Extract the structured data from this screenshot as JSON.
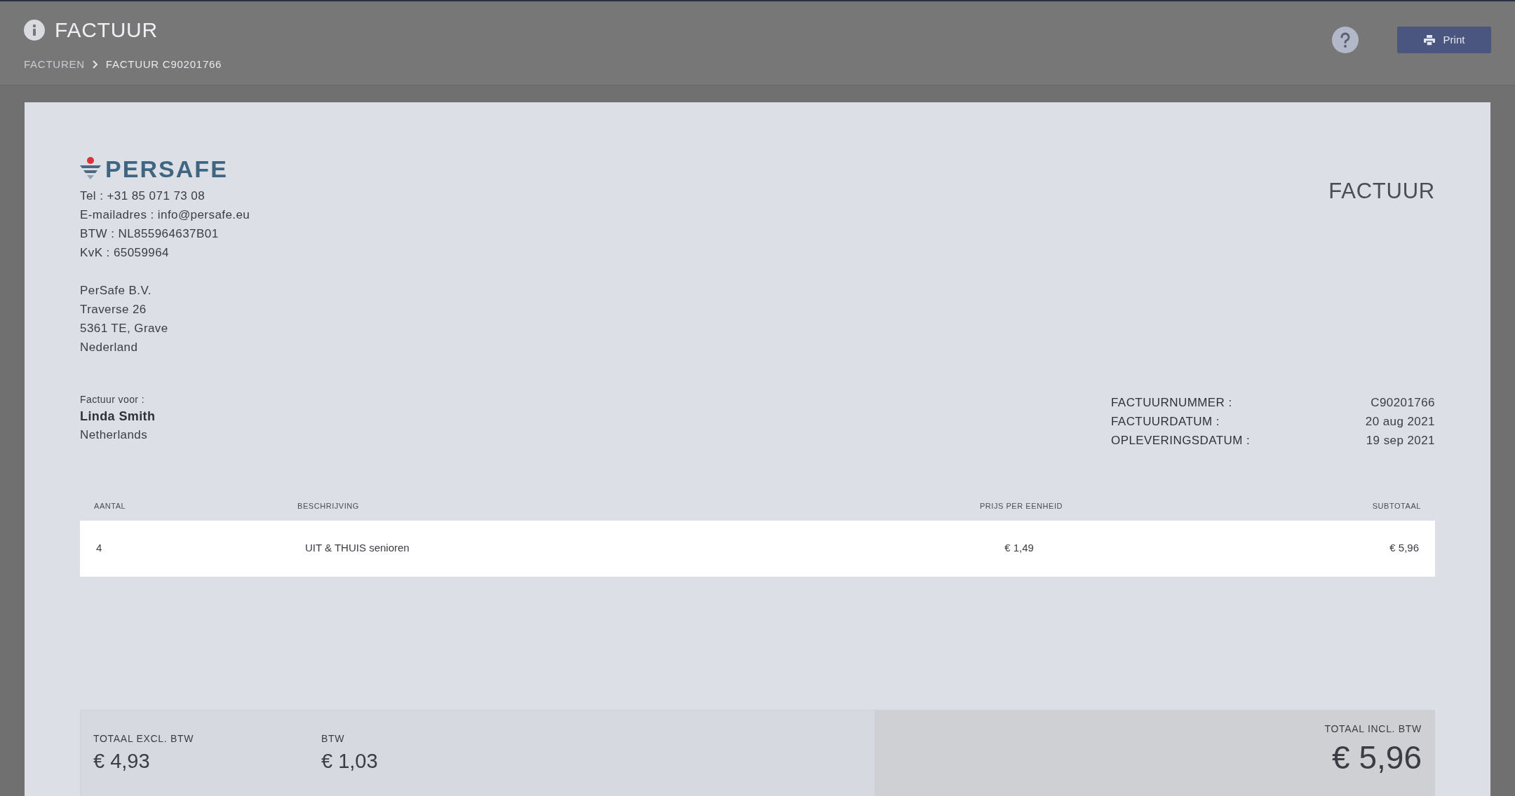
{
  "header": {
    "title": "FACTUUR",
    "breadcrumb": [
      "FACTUREN",
      "FACTUUR C90201766"
    ],
    "print_button": "Print"
  },
  "invoice": {
    "heading": "FACTUUR",
    "logo_text": "PERSAFE",
    "company_contact": [
      "Tel : +31 85 071 73 08",
      "E-mailadres : info@persafe.eu",
      "BTW : NL855964637B01",
      "KvK : 65059964"
    ],
    "company_address": [
      "PerSafe B.V.",
      "Traverse 26",
      "5361 TE, Grave",
      "Nederland"
    ],
    "recipient": {
      "label": "Factuur voor :",
      "name": "Linda Smith",
      "country": "Netherlands"
    },
    "meta": [
      {
        "label": "FACTUURNUMMER :",
        "value": "C90201766"
      },
      {
        "label": "FACTUURDATUM :",
        "value": "20 aug 2021"
      },
      {
        "label": "OPLEVERINGSDATUM :",
        "value": "19 sep 2021"
      }
    ],
    "table": {
      "columns": [
        "AANTAL",
        "BESCHRIJVING",
        "PRIJS PER EENHEID",
        "SUBTOTAAL"
      ],
      "rows": [
        [
          "4",
          "UIT & THUIS senioren",
          "€ 1,49",
          "€ 5,96"
        ]
      ]
    },
    "totals": [
      {
        "label": "TOTAAL EXCL. BTW",
        "value": "€ 4,93"
      },
      {
        "label": "BTW",
        "value": "€ 1,03"
      }
    ],
    "grand_total": {
      "label": "TOTAAL INCL. BTW",
      "value": "€ 5,96"
    }
  }
}
